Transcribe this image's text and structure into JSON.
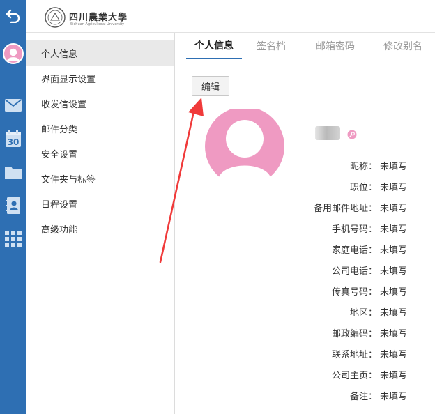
{
  "colors": {
    "rail": "#2e6fb3",
    "accent_pink": "#ef9ac2",
    "annotation_arrow": "#f03a3a"
  },
  "logo": {
    "name_cn": "四川農業大學",
    "name_en": "Sichuan Agricultural University"
  },
  "rail_icons": [
    "back-arrow-icon",
    "profile-avatar-icon",
    "mail-icon",
    "calendar-icon",
    "folder-icon",
    "contacts-icon",
    "apps-grid-icon"
  ],
  "calendar_day": "30",
  "settings_nav": {
    "items": [
      {
        "label": "个人信息",
        "active": true
      },
      {
        "label": "界面显示设置"
      },
      {
        "label": "收发信设置"
      },
      {
        "label": "邮件分类"
      },
      {
        "label": "安全设置"
      },
      {
        "label": "文件夹与标签"
      },
      {
        "label": "日程设置"
      },
      {
        "label": "高级功能"
      }
    ]
  },
  "tabs": [
    {
      "label": "个人信息",
      "active": true
    },
    {
      "label": "签名档"
    },
    {
      "label": "邮箱密码"
    },
    {
      "label": "修改别名"
    }
  ],
  "edit_button": "编辑",
  "profile": {
    "fields": [
      {
        "label": "昵称：",
        "value": "未填写"
      },
      {
        "label": "职位：",
        "value": "未填写"
      },
      {
        "label": "备用邮件地址：",
        "value": "未填写"
      },
      {
        "label": "手机号码：",
        "value": "未填写"
      },
      {
        "label": "家庭电话：",
        "value": "未填写"
      },
      {
        "label": "公司电话：",
        "value": "未填写"
      },
      {
        "label": "传真号码：",
        "value": "未填写"
      },
      {
        "label": "地区：",
        "value": "未填写"
      },
      {
        "label": "邮政编码：",
        "value": "未填写"
      },
      {
        "label": "联系地址：",
        "value": "未填写"
      },
      {
        "label": "公司主页：",
        "value": "未填写"
      },
      {
        "label": "备注：",
        "value": "未填写"
      }
    ]
  }
}
